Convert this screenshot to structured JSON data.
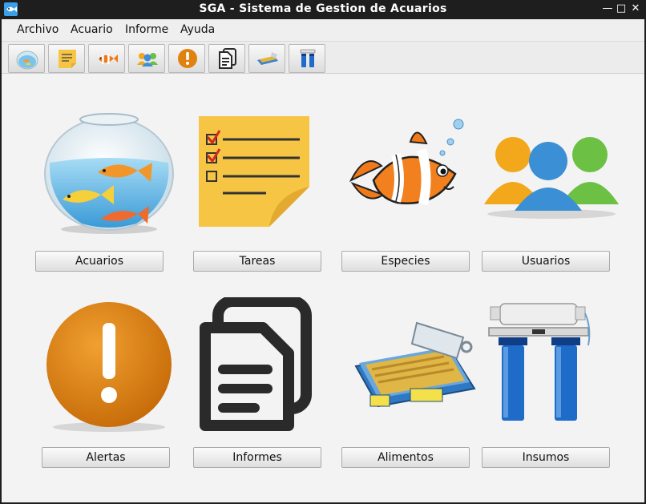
{
  "window": {
    "title": "SGA  -  Sistema de Gestion de Acuarios"
  },
  "menu": [
    "Archivo",
    "Acuario",
    "Informe",
    "Ayuda"
  ],
  "toolbar": [
    {
      "name": "fishbowl-icon"
    },
    {
      "name": "sticky-note-icon"
    },
    {
      "name": "clownfish-icon"
    },
    {
      "name": "users-icon"
    },
    {
      "name": "alert-icon"
    },
    {
      "name": "documents-icon"
    },
    {
      "name": "food-can-icon"
    },
    {
      "name": "water-filter-icon"
    }
  ],
  "tiles": {
    "acuarios": "Acuarios",
    "tareas": "Tareas",
    "especies": "Especies",
    "usuarios": "Usuarios",
    "alertas": "Alertas",
    "informes": "Informes",
    "alimentos": "Alimentos",
    "insumos": "Insumos"
  },
  "colors": {
    "titlebar": "#1e1e1e",
    "background": "#f3f3f3",
    "note": "#f7c544",
    "alert": "#d9790f"
  }
}
